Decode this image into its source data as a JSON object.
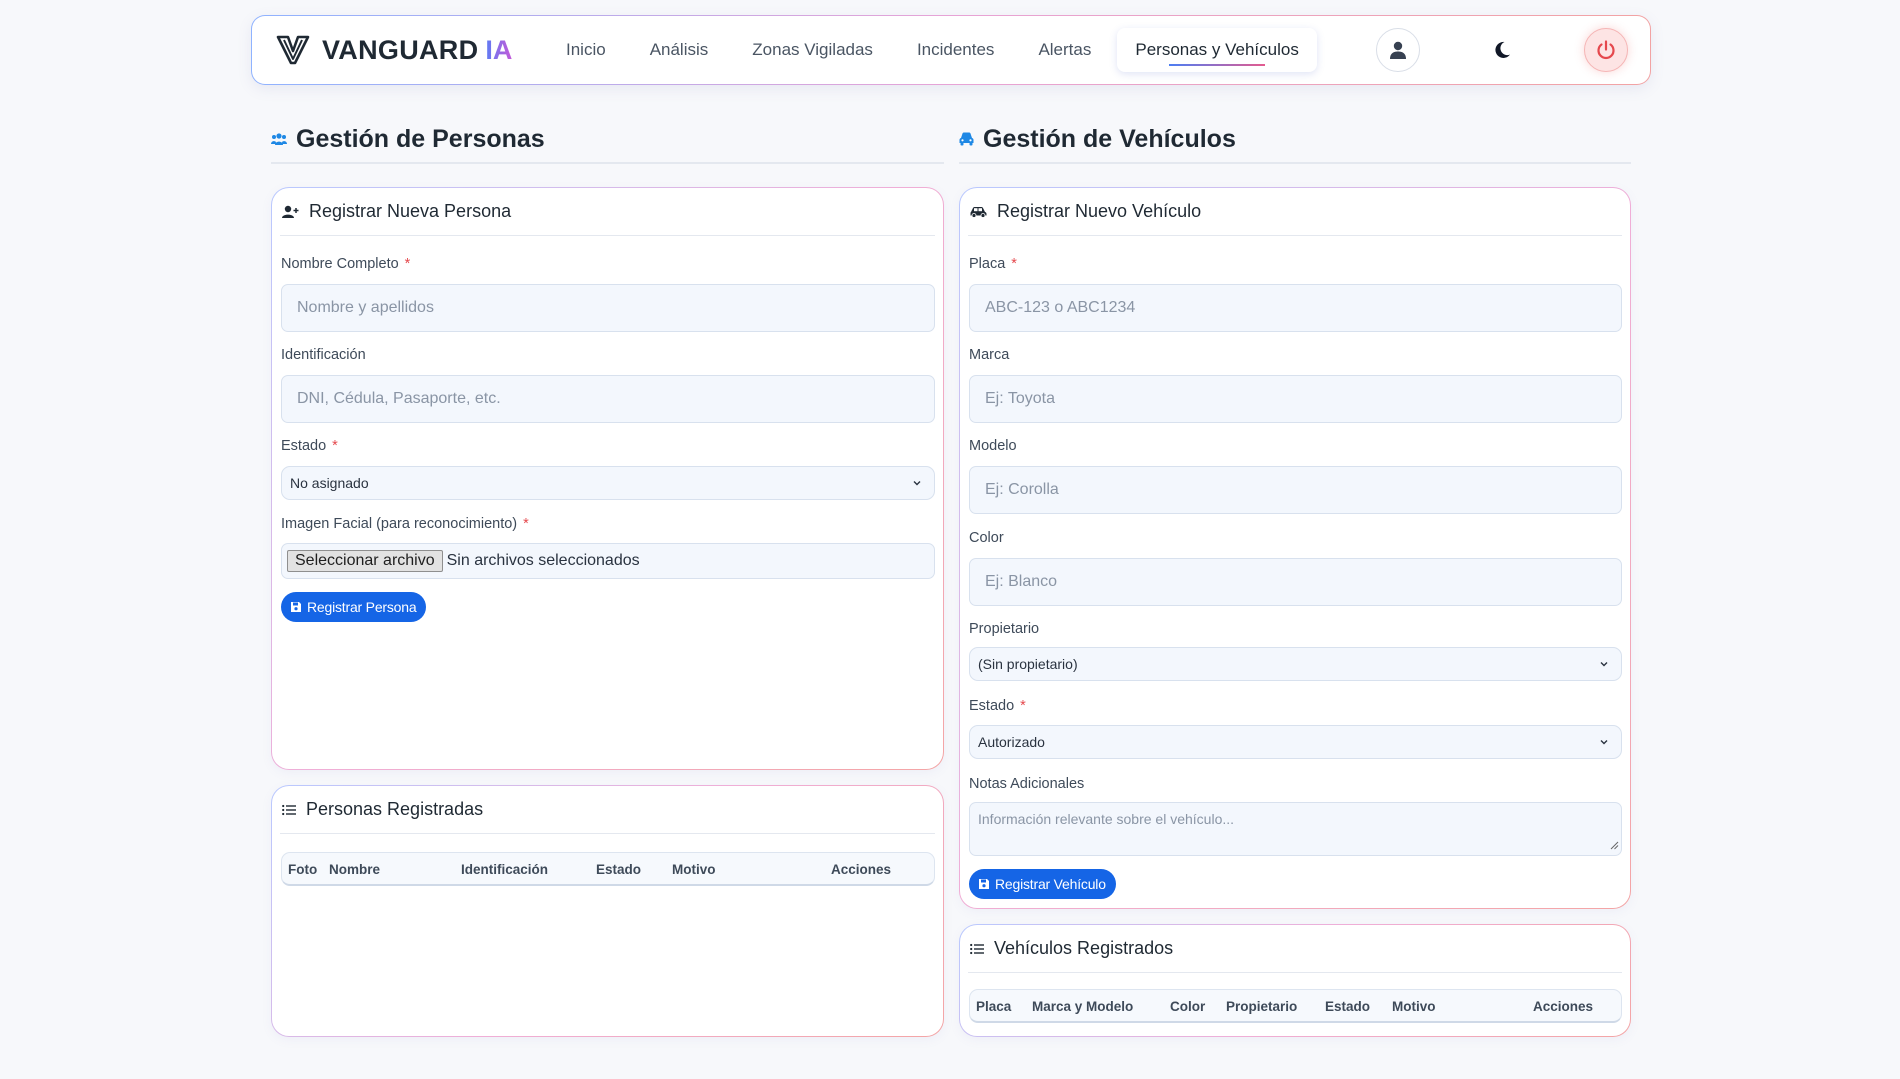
{
  "brand": {
    "name": "VANGUARD",
    "suffix": "IA",
    "logo_icon": "v-shield-logo-icon"
  },
  "nav": {
    "links": [
      "Inicio",
      "Análisis",
      "Zonas Vigiladas",
      "Incidentes",
      "Alertas",
      "Personas y Vehículos"
    ],
    "active_index": 5
  },
  "header_icons": {
    "user": "user-icon",
    "theme": "moon-icon",
    "logout": "power-icon"
  },
  "colors": {
    "accent": "#1565e6",
    "logout": "#e5484d",
    "required": "#e5484d"
  },
  "personas": {
    "section_title": "Gestión de Personas",
    "form": {
      "title": "Registrar Nueva Persona",
      "nombre_label": "Nombre Completo",
      "nombre_placeholder": "Nombre y apellidos",
      "id_label": "Identificación",
      "id_placeholder": "DNI, Cédula, Pasaporte, etc.",
      "estado_label": "Estado",
      "estado_value": "No asignado",
      "imagen_label": "Imagen Facial (para reconocimiento)",
      "file_button": "Seleccionar archivo",
      "file_status": "Sin archivos seleccionados",
      "submit": "Registrar Persona"
    },
    "list": {
      "title": "Personas Registradas",
      "columns": [
        "Foto",
        "Nombre",
        "Identificación",
        "Estado",
        "Motivo",
        "Acciones"
      ]
    }
  },
  "vehiculos": {
    "section_title": "Gestión de Vehículos",
    "form": {
      "title": "Registrar Nuevo Vehículo",
      "placa_label": "Placa",
      "placa_placeholder": "ABC-123 o ABC1234",
      "marca_label": "Marca",
      "marca_placeholder": "Ej: Toyota",
      "modelo_label": "Modelo",
      "modelo_placeholder": "Ej: Corolla",
      "color_label": "Color",
      "color_placeholder": "Ej: Blanco",
      "propietario_label": "Propietario",
      "propietario_value": "(Sin propietario)",
      "estado_label": "Estado",
      "estado_value": "Autorizado",
      "notas_label": "Notas Adicionales",
      "notas_placeholder": "Información relevante sobre el vehículo...",
      "submit": "Registrar Vehículo"
    },
    "list": {
      "title": "Vehículos Registrados",
      "columns": [
        "Placa",
        "Marca y Modelo",
        "Color",
        "Propietario",
        "Estado",
        "Motivo",
        "Acciones"
      ]
    }
  },
  "required_mark": "*"
}
